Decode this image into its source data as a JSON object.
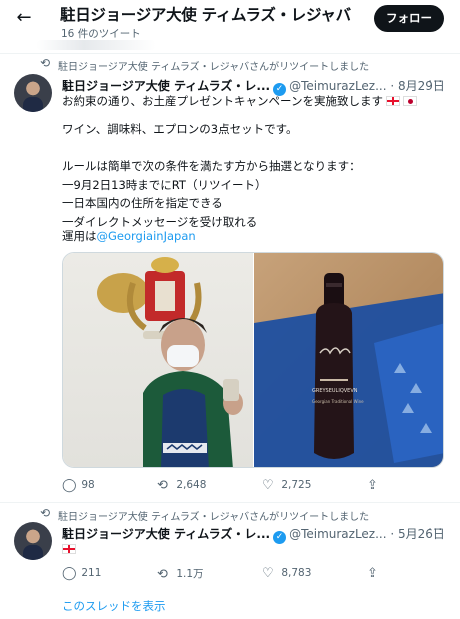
{
  "header": {
    "profile_name": "駐日ジョージア大使 ティムラズ・レジャバ",
    "tweet_count": "16 件のツイート",
    "follow_label": "フォロー"
  },
  "tweet1": {
    "retweet_note": "駐日ジョージア大使 ティムラズ・レジャバさんがリツイートしました",
    "author": "駐日ジョージア大使 ティムラズ・レ...",
    "handle": "@TeimurazLez...",
    "date": "· 8月29日",
    "line1": "お約束の通り、お土産プレゼントキャンペーンを実施致します",
    "body": "ワイン、調味料、エプロンの3点セットです。\n\nルールは簡単で次の条件を満たす方から抽選となります：\n一9月2日13時までにRT（リツイート）\n一日本国内の住所を指定できる\n一ダイレクトメッセージを受け取れる",
    "operated_by": "運用は",
    "mention": "@GeorgiainJapan",
    "wine_label": "GREYSEULIQVEVN",
    "wine_sub": "Georgian Traditional Wine",
    "actions": {
      "replies": "98",
      "retweets": "2,648",
      "likes": "2,725"
    }
  },
  "tweet2": {
    "retweet_note": "駐日ジョージア大使 ティムラズ・レジャバさんがリツイートしました",
    "author": "駐日ジョージア大使 ティムラズ・レ...",
    "handle": "@TeimurazLez...",
    "date": "· 5月26日",
    "actions": {
      "replies": "211",
      "retweets": "1.1万",
      "likes": "8,783"
    }
  },
  "show_thread": "このスレッドを表示",
  "icons": {
    "back": "arrow-left-icon",
    "retweet": "retweet-icon",
    "verified": "verified-badge-icon",
    "more": "more-icon",
    "reply": "reply-icon",
    "like": "heart-icon",
    "share": "share-icon"
  },
  "colors": {
    "accent": "#1d9bf0",
    "text": "#0f1419",
    "muted": "#536471",
    "button": "#0f1419"
  }
}
